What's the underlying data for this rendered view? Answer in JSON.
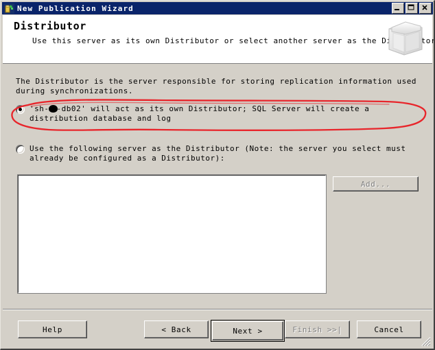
{
  "window": {
    "title": "New Publication Wizard",
    "icon": "publication-wizard-icon",
    "controls": {
      "minimize": "minimize-icon",
      "maximize": "maximize-icon",
      "close": "close-icon"
    }
  },
  "header": {
    "title": "Distributor",
    "subtitle": "Use this server as its own Distributor or select another server as the Distributor.",
    "icon": "distributor-book-icon"
  },
  "body": {
    "description": "The Distributor is the server responsible for storing replication information used during synchronizations.",
    "options": [
      {
        "name": "use-own-distributor",
        "checked": true,
        "label_before": "'sh-",
        "redacted": true,
        "label_after": "-db02' will act as its own Distributor; SQL Server will create a distribution database and log"
      },
      {
        "name": "use-following-server",
        "checked": false,
        "label": "Use the following server as the Distributor (Note: the server you select must already be configured as a Distributor):"
      }
    ],
    "server_list": {
      "items": [],
      "name": "distributor-server-list"
    },
    "add_button": {
      "label": "Add...",
      "enabled": false
    }
  },
  "footer": {
    "buttons": [
      {
        "name": "help-button",
        "label": "Help",
        "enabled": true,
        "default": false
      },
      {
        "name": "back-button",
        "label": "< Back",
        "enabled": true,
        "default": false
      },
      {
        "name": "next-button",
        "label": "Next >",
        "enabled": true,
        "default": true
      },
      {
        "name": "finish-button",
        "label": "Finish >>|",
        "enabled": false,
        "default": false
      },
      {
        "name": "cancel-button",
        "label": "Cancel",
        "enabled": true,
        "default": false
      }
    ]
  },
  "annotation": {
    "type": "hand-drawn-ellipse",
    "color": "#e8252b",
    "target": "use-own-distributor"
  },
  "colors": {
    "titlebar": "#0a246a",
    "dialog_face": "#d4d0c8",
    "header_band": "#ffffff",
    "annotation": "#e8252b"
  }
}
